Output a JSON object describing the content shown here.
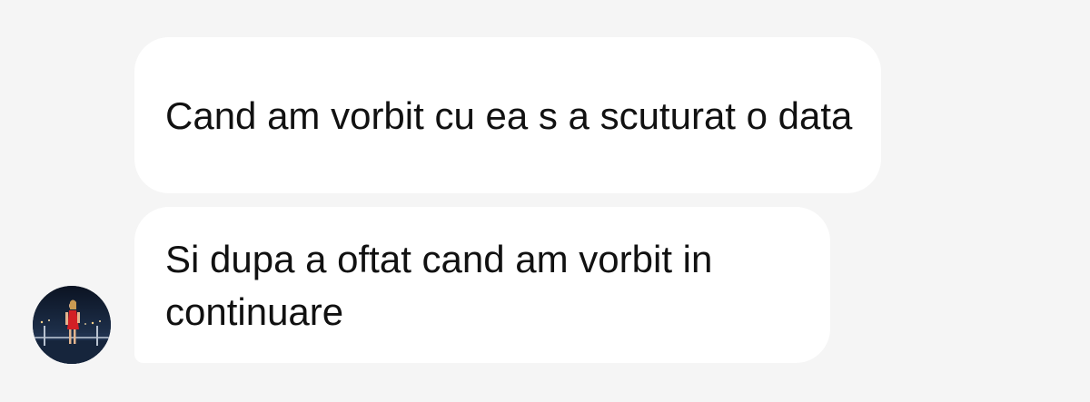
{
  "messages": [
    {
      "text": "Cand am vorbit cu ea s a scuturat o data"
    },
    {
      "text": "Si dupa a oftat cand am vorbit in continuare"
    }
  ],
  "avatar": {
    "icon": "profile-photo-woman-red-dress"
  },
  "colors": {
    "background": "#f5f5f5",
    "bubble": "#ffffff",
    "text": "#111111"
  }
}
